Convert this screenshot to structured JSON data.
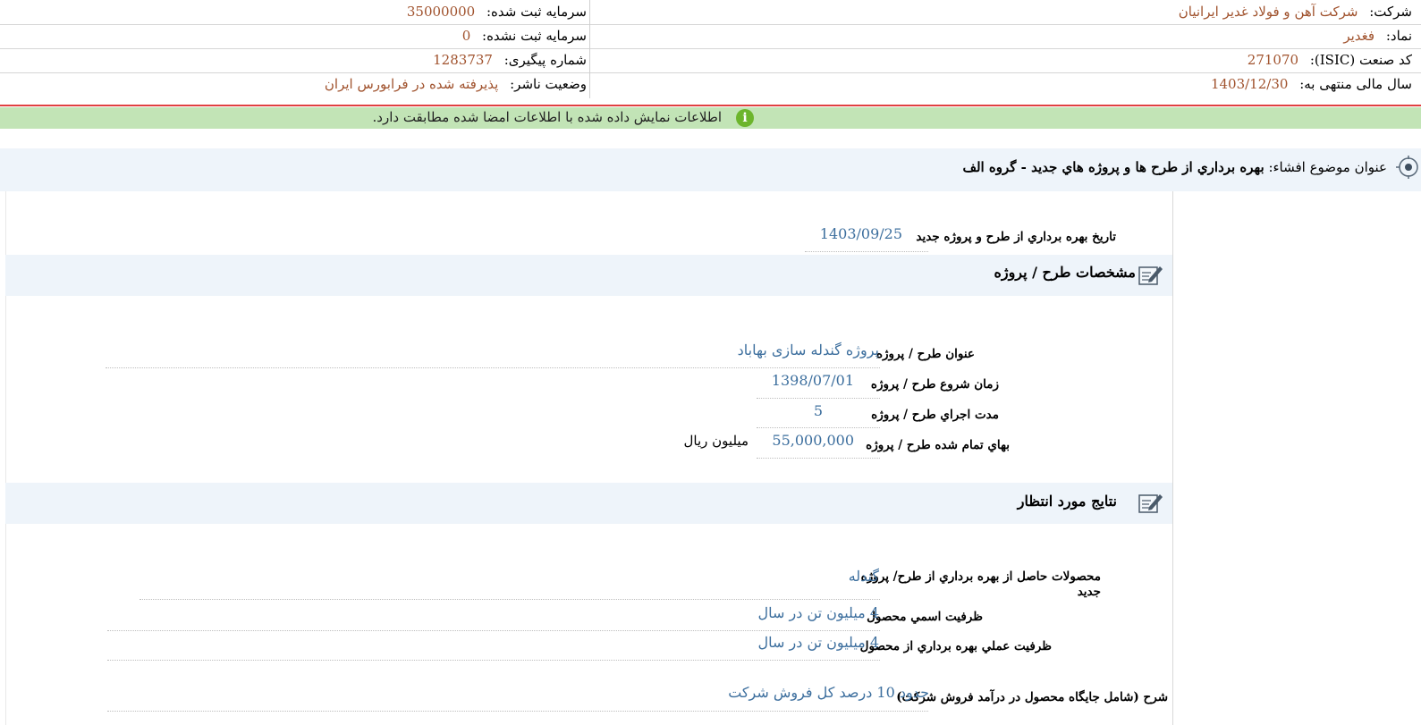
{
  "header": {
    "company_label": "شرکت:",
    "company_value": "شرکت آهن و فولاد غدیر ایرانیان",
    "symbol_label": "نماد:",
    "symbol_value": "فغدیر",
    "isic_label": "کد صنعت (ISIC):",
    "isic_value": "271070",
    "fiscal_label": "سال مالی منتهی به:",
    "fiscal_value": "1403/12/30",
    "reg_capital_label": "سرمایه ثبت شده:",
    "reg_capital_value": "35000000",
    "unreg_capital_label": "سرمایه ثبت نشده:",
    "unreg_capital_value": "0",
    "tracking_label": "شماره پیگیری:",
    "tracking_value": "1283737",
    "status_label": "وضعیت ناشر:",
    "status_value": "پذیرفته شده در فرابورس ایران"
  },
  "notice": {
    "text": "اطلاعات نمایش داده شده با اطلاعات امضا شده مطابقت دارد.",
    "icon": "info-icon",
    "color": "#c2e4b6"
  },
  "subject": {
    "label": "عنوان موضوع افشاء:",
    "value": "بهره برداري از طرح ها و پروژه هاي جديد - گروه الف"
  },
  "exploitation": {
    "date_label": "تاريخ بهره برداري از طرح و پروژه جديد",
    "date_value": "1403/09/25"
  },
  "project_section": {
    "title": "مشخصات طرح / پروژه",
    "title_label": "عنوان طرح / پروژه",
    "title_value": "پروژه گندله سازی بهاباد",
    "start_label": "زمان شروع طرح / پروژه",
    "start_value": "1398/07/01",
    "duration_label": "مدت اجراي طرح / پروژه",
    "duration_value": "5",
    "cost_label": "بهاي تمام شده طرح / پروژه",
    "cost_value": "55,000,000",
    "cost_unit": "میلیون ریال"
  },
  "results_section": {
    "title": "نتايج مورد انتظار",
    "products_label_line1": "محصولات حاصل از بهره برداري از طرح/ پروژه",
    "products_label_line2": "جديد",
    "products_value": "گندله",
    "nominal_label": "ظرفيت اسمي محصول",
    "nominal_value": "4 میلیون تن در سال",
    "practical_label": "ظرفيت عملي بهره برداري از محصول",
    "practical_value": "4 میلیون تن در سال",
    "desc_label": "شرح (شامل جايگاه محصول در درآمد فروش شرکت)",
    "desc_value": "حدود 10 درصد کل فروش شرکت"
  },
  "colors": {
    "value_brown": "#a0522d",
    "value_blue": "#3d6f9e",
    "section_bg": "#eef4fa",
    "red_rule": "#e04040"
  }
}
